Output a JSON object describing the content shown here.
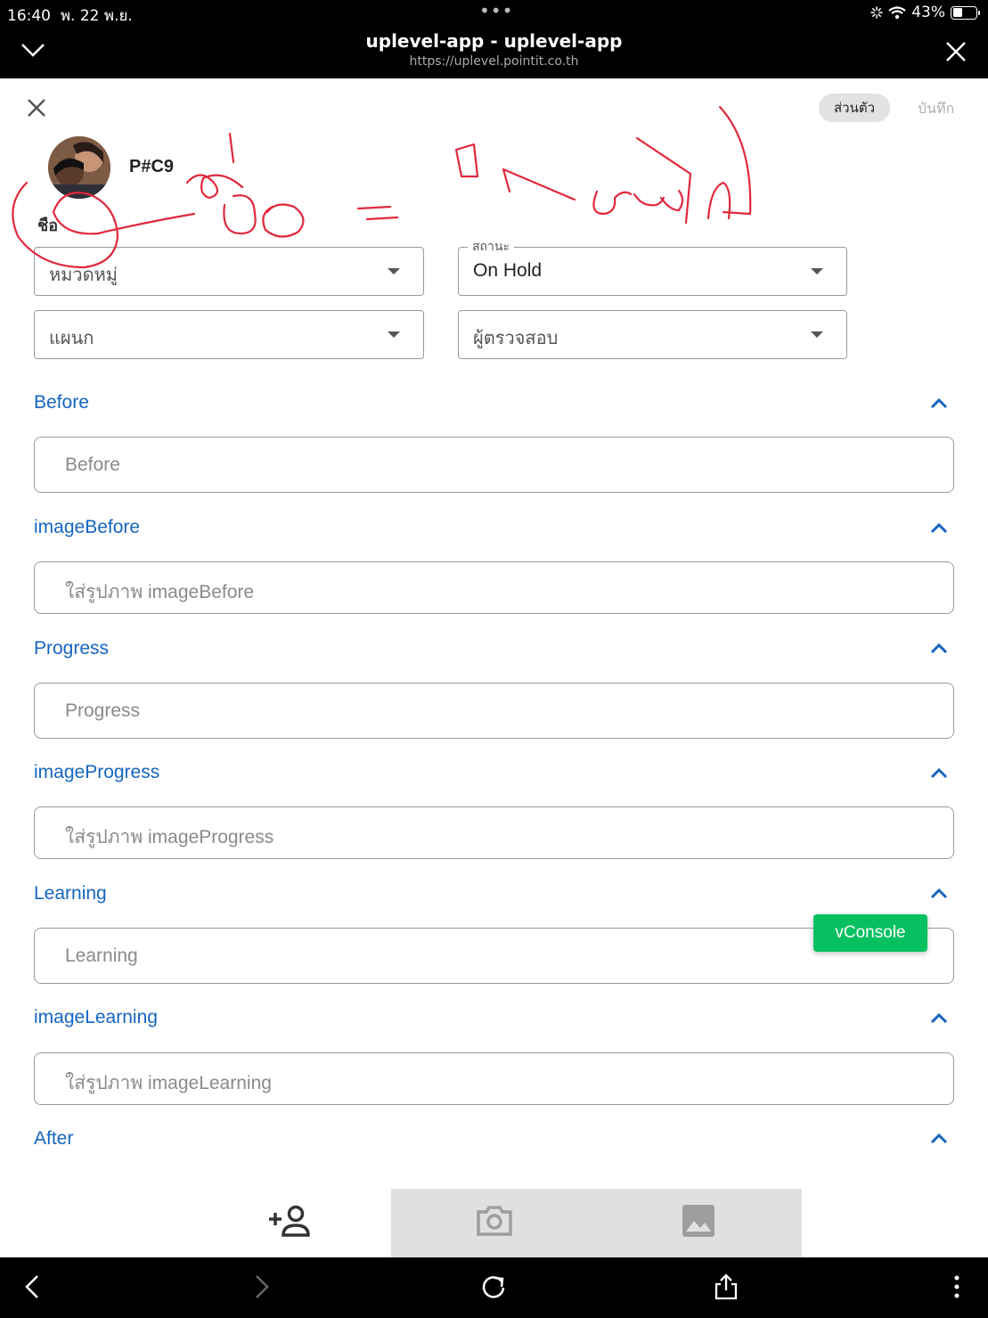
{
  "status_bar": {
    "time": "16:40",
    "date": "พ. 22 พ.ย.",
    "dots": "•••",
    "battery": "43%",
    "battery_level": 0.43
  },
  "browser": {
    "title": "uplevel-app - uplevel-app",
    "url": "https://uplevel.pointit.co.th"
  },
  "header": {
    "privacy_label": "ส่วนตัว",
    "save_label": "บันทึก"
  },
  "user": {
    "name": "P#C9",
    "name_label": "ชือ"
  },
  "selects": {
    "category": {
      "value": "หมวดหมู่"
    },
    "status": {
      "legend": "สถานะ",
      "value": "On Hold"
    },
    "department": {
      "value": "แผนก"
    },
    "reviewer": {
      "value": "ผู้ตรวจสอบ"
    }
  },
  "sections": [
    {
      "title": "Before",
      "placeholder": "Before"
    },
    {
      "title": "imageBefore",
      "placeholder": "ใส่รูปภาพ imageBefore"
    },
    {
      "title": "Progress",
      "placeholder": "Progress"
    },
    {
      "title": "imageProgress",
      "placeholder": "ใส่รูปภาพ imageProgress"
    },
    {
      "title": "Learning",
      "placeholder": "Learning"
    },
    {
      "title": "imageLearning",
      "placeholder": "ใส่รูปภาพ imageLearning"
    },
    {
      "title": "After"
    }
  ],
  "vconsole": "vConsole",
  "toolbar": {
    "icons": [
      "add-person-icon",
      "camera-icon",
      "image-icon"
    ]
  },
  "navbar": {
    "icons": [
      "back-icon",
      "forward-icon",
      "reload-icon",
      "share-icon",
      "more-icon"
    ]
  },
  "colors": {
    "accent": "#1565c0",
    "vconsole": "#07c160",
    "annotation": "#e0283c"
  }
}
